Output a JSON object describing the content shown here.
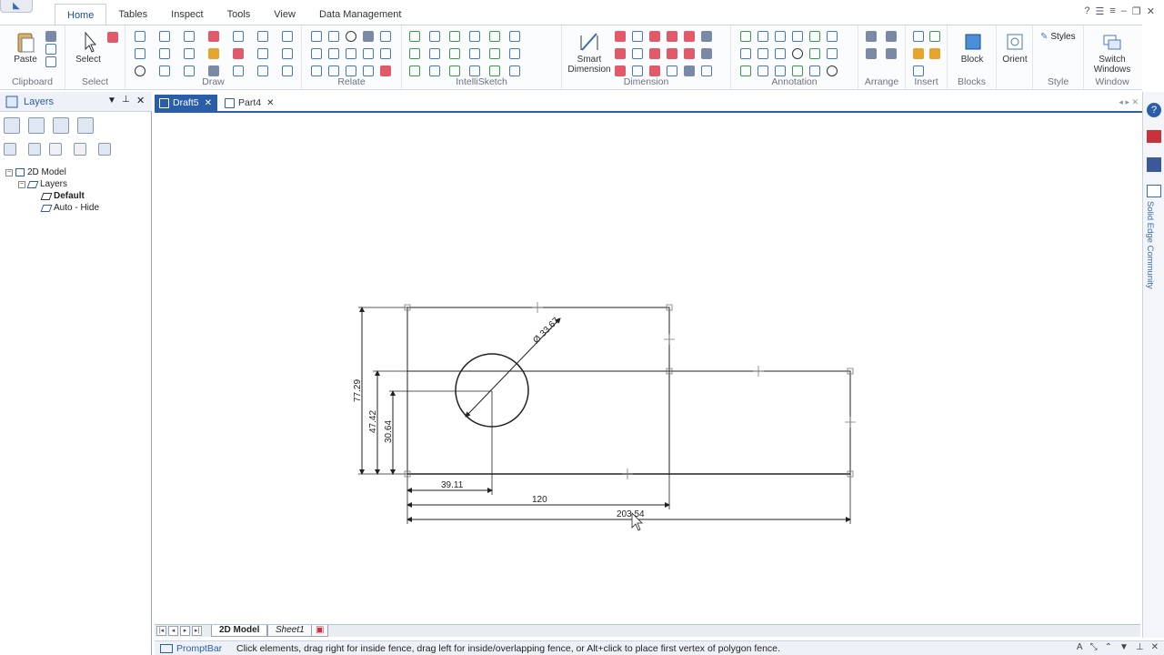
{
  "ribbon": {
    "tabs": [
      "Home",
      "Tables",
      "Inspect",
      "Tools",
      "View",
      "Data Management"
    ],
    "active_tab": "Home",
    "groups": {
      "clipboard": {
        "label": "Clipboard",
        "paste": "Paste"
      },
      "select": {
        "label": "Select",
        "select": "Select"
      },
      "draw": {
        "label": "Draw"
      },
      "relate": {
        "label": "Relate"
      },
      "intellisketch": {
        "label": "IntelliSketch"
      },
      "dimension": {
        "label": "Dimension",
        "smart_line1": "Smart",
        "smart_line2": "Dimension"
      },
      "annotation": {
        "label": "Annotation"
      },
      "arrange": {
        "label": "Arrange"
      },
      "insert": {
        "label": "Insert"
      },
      "blocks": {
        "label": "Blocks",
        "block": "Block"
      },
      "orient": {
        "orient": "Orient"
      },
      "style": {
        "label": "Style",
        "styles": "Styles"
      },
      "window": {
        "label": "Window",
        "switch_line1": "Switch",
        "switch_line2": "Windows"
      }
    }
  },
  "layers_pane": {
    "title": "Layers",
    "tree": {
      "root": "2D Model",
      "group": "Layers",
      "items": [
        "Default",
        "Auto - Hide"
      ]
    }
  },
  "doc_tabs": [
    {
      "label": "Draft5",
      "active": true
    },
    {
      "label": "Part4",
      "active": false
    }
  ],
  "drawing": {
    "dim_diameter": "Ø 33.67",
    "dim_height_total": "77.29",
    "dim_height_rect": "47.42",
    "dim_circle_y": "30.64",
    "dim_circle_x": "39.11",
    "dim_width_top": "120",
    "dim_width_total": "203.54"
  },
  "sheet_tabs": [
    {
      "label": "2D Model",
      "active": true
    },
    {
      "label": "Sheet1",
      "active": false
    }
  ],
  "status": {
    "promptbar_label": "PromptBar",
    "prompt": "Click elements, drag right for inside fence, drag left for inside/overlapping fence, or Alt+click to place first vertex of polygon fence."
  },
  "right_rail": {
    "label": "Solid Edge Community"
  }
}
